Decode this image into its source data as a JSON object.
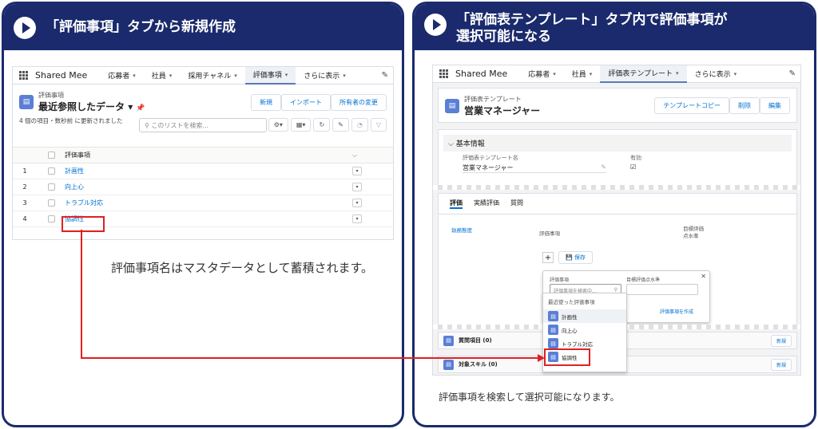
{
  "left": {
    "header": "「評価事項」タブから新規作成",
    "app_name": "Shared Mee",
    "nav": [
      "応募者",
      "社員",
      "採用チャネル",
      "評価事項",
      "さらに表示"
    ],
    "object_label": "評価事項",
    "list_view": "最近参照したデータ",
    "buttons": [
      "新規",
      "インポート",
      "所有者の変更"
    ],
    "status": "4 個の項目・数秒前 に更新されました",
    "search_placeholder": "このリストを検索...",
    "column_header": "評価事項",
    "rows": [
      {
        "num": "1",
        "name": "計画性"
      },
      {
        "num": "2",
        "name": "向上心"
      },
      {
        "num": "3",
        "name": "トラブル対応"
      },
      {
        "num": "4",
        "name": "協調性"
      }
    ],
    "caption": "評価事項名はマスタデータとして蓄積されます。"
  },
  "right": {
    "header_line1": "「評価表テンプレート」タブ内で評価事項が",
    "header_line2": "選択可能になる",
    "app_name": "Shared Mee",
    "nav": [
      "応募者",
      "社員",
      "評価表テンプレート",
      "さらに表示"
    ],
    "object_label": "評価表テンプレート",
    "record_name": "営業マネージャー",
    "buttons": [
      "テンプレートコピー",
      "削除",
      "編集"
    ],
    "section": "基本情報",
    "field_label_1": "評価表テンプレート名",
    "field_value_1": "営業マネージャー",
    "field_label_2": "有効",
    "tabs": [
      "評価",
      "実績評価",
      "質問"
    ],
    "category": "執務態度",
    "col_item": "評価事項",
    "col_target_1": "目標評価",
    "col_target_2": "点水準",
    "save_label": "保存",
    "popup_label_1": "評価事項",
    "popup_label_2": "目標評価点水準",
    "popup_placeholder": "評価事項を検索中...",
    "recent_label": "最近使った評価事項",
    "create_link": "評価事項を作成",
    "recent_items": [
      "計画性",
      "向上心",
      "トラブル対応",
      "協調性"
    ],
    "related_1": "質問項目 (0)",
    "related_2": "対象スキル (0)",
    "new_label": "新規",
    "caption": "評価事項を検索して選択可能になります。"
  },
  "colors": {
    "navy": "#1a2a6c",
    "highlight": "#e02020",
    "sf_blue": "#0070d2"
  }
}
